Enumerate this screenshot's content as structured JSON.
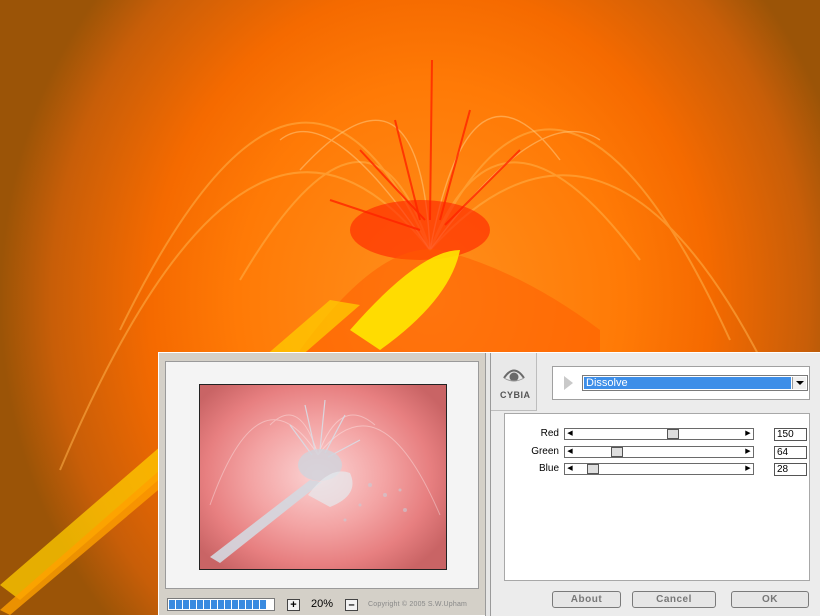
{
  "background": {
    "description_colors": {
      "primary": "#ff7a06",
      "hot": "#ffee00",
      "lava": "#ff1a00",
      "edge": "#9b5407"
    }
  },
  "dialog": {
    "preview": {
      "zoom_in_label": "+",
      "zoom_out_label": "–",
      "zoom_value": "20%",
      "copyright": "Copyright © 2005  S.W.Upham",
      "progress_fraction": 1.0
    },
    "logo": {
      "name": "CYBIA",
      "icon": "eye-icon"
    },
    "filter": {
      "selected": "Dissolve"
    },
    "params": [
      {
        "label": "Red",
        "value": "150",
        "fraction": 0.59
      },
      {
        "label": "Green",
        "value": "64",
        "fraction": 0.25
      },
      {
        "label": "Blue",
        "value": "28",
        "fraction": 0.11
      }
    ],
    "buttons": {
      "about": "About",
      "cancel": "Cancel",
      "ok": "OK"
    },
    "accent_color": "#3d8ee8"
  }
}
